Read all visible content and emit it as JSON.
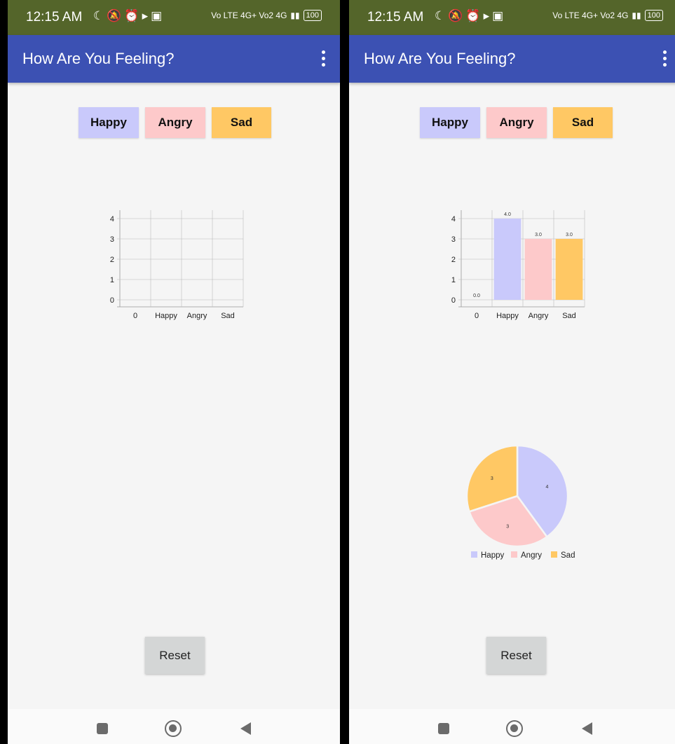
{
  "screens": [
    {
      "status_bar": {
        "time": "12:15 AM",
        "network": "Vo LTE 4G+ Vo2 4G",
        "battery": "100"
      },
      "app_bar": {
        "title": "How Are You Feeling?"
      },
      "mood_buttons": [
        {
          "label": "Happy",
          "color": "#c9c9fb"
        },
        {
          "label": "Angry",
          "color": "#fdc9ca"
        },
        {
          "label": "Sad",
          "color": "#ffc864"
        }
      ],
      "reset_label": "Reset"
    },
    {
      "status_bar": {
        "time": "12:15 AM",
        "network": "Vo LTE 4G+ Vo2 4G",
        "battery": "100"
      },
      "app_bar": {
        "title": "How Are You Feeling?"
      },
      "mood_buttons": [
        {
          "label": "Happy",
          "color": "#c9c9fb"
        },
        {
          "label": "Angry",
          "color": "#fdc9ca"
        },
        {
          "label": "Sad",
          "color": "#ffc864"
        }
      ],
      "reset_label": "Reset"
    }
  ],
  "chart_data": [
    {
      "type": "bar",
      "categories": [
        "0",
        "Happy",
        "Angry",
        "Sad"
      ],
      "values": [],
      "ylim": [
        0,
        4
      ],
      "yticks": [
        "0",
        "1",
        "2",
        "3",
        "4"
      ],
      "grid": true
    },
    {
      "type": "bar",
      "categories": [
        "0",
        "Happy",
        "Angry",
        "Sad"
      ],
      "values": [
        0,
        4,
        3,
        3
      ],
      "value_labels": [
        "0.0",
        "4.0",
        "3.0",
        "3.0"
      ],
      "colors": [
        "#c9c9fb",
        "#c9c9fb",
        "#fdc9ca",
        "#ffc864"
      ],
      "ylim": [
        0,
        4
      ],
      "yticks": [
        "0",
        "1",
        "2",
        "3",
        "4"
      ],
      "grid": true
    },
    {
      "type": "pie",
      "labels": [
        "Happy",
        "Angry",
        "Sad"
      ],
      "values": [
        4,
        3,
        3
      ],
      "slice_labels": [
        "4",
        "3",
        "3"
      ],
      "colors": [
        "#c9c9fb",
        "#fdc9ca",
        "#ffc864"
      ],
      "legend": "bottom"
    }
  ]
}
